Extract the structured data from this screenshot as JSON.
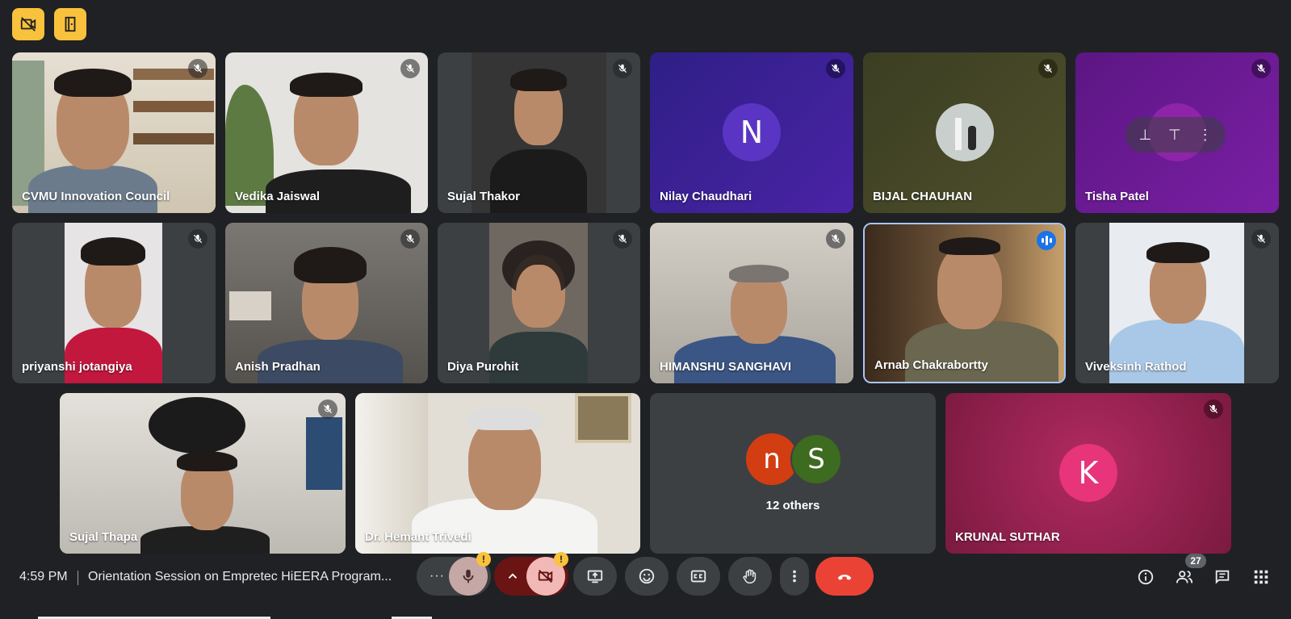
{
  "participants": [
    {
      "name": "CVMU Innovation Council"
    },
    {
      "name": "Vedika Jaiswal"
    },
    {
      "name": "Sujal Thakor"
    },
    {
      "name": "Nilay Chaudhari",
      "initial": "N"
    },
    {
      "name": "BIJAL CHAUHAN"
    },
    {
      "name": "Tisha Patel"
    },
    {
      "name": "priyanshi jotangiya"
    },
    {
      "name": "Anish Pradhan"
    },
    {
      "name": "Diya Purohit"
    },
    {
      "name": "HIMANSHU SANGHAVI"
    },
    {
      "name": "Arnab Chakrabortty"
    },
    {
      "name": "Viveksinh Rathod"
    },
    {
      "name": "Sujal Thapa"
    },
    {
      "name": "Dr. Hemant Trivedi"
    },
    {
      "name": "KRUNAL SUTHAR",
      "initial": "K"
    }
  ],
  "others": {
    "label": "12 others",
    "initials": [
      "n",
      "S"
    ]
  },
  "bottom": {
    "time": "4:59 PM",
    "meeting_title": "Orientation Session on Empretec HiEERA Program...",
    "people_count": "27",
    "warn_mark": "!"
  },
  "colors": {
    "accent_yellow": "#f9c23c",
    "end_call_red": "#ea4335",
    "speaking_blue": "#a8c7fa"
  }
}
